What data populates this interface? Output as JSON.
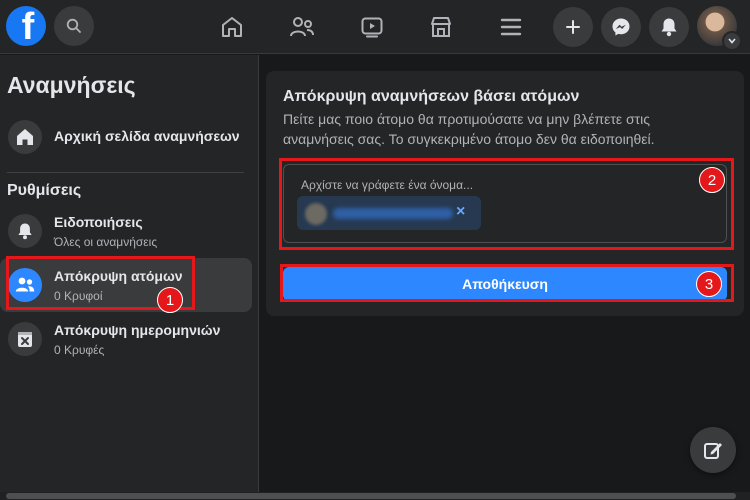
{
  "topbar": {
    "logo_letter": "f",
    "nav": [
      "home-icon",
      "friends-icon",
      "watch-icon",
      "marketplace-icon",
      "menu-icon"
    ],
    "actions": [
      "create-icon",
      "messenger-icon",
      "notifications-icon"
    ]
  },
  "sidebar": {
    "title": "Αναμνήσεις",
    "home_item": {
      "label": "Αρχική σελίδα αναμνήσεων",
      "icon": "home-icon"
    },
    "settings_heading": "Ρυθμίσεις",
    "items": [
      {
        "label": "Ειδοποιήσεις",
        "sub": "Όλες οι αναμνήσεις",
        "icon": "bell-icon"
      },
      {
        "label": "Απόκρυψη ατόμων",
        "sub": "0 Κρυφοί",
        "icon": "people-icon",
        "active": true
      },
      {
        "label": "Απόκρυψη ημερομηνιών",
        "sub": "0 Κρυφές",
        "icon": "calendar-x-icon"
      }
    ]
  },
  "panel": {
    "title": "Απόκρυψη αναμνήσεων βάσει ατόμων",
    "description": "Πείτε μας ποιο άτομο θα προτιμούσατε να μην βλέπετε στις αναμνήσεις σας. Το συγκεκριμένο άτομο δεν θα ειδοποιηθεί.",
    "input_placeholder": "Αρχίστε να γράφετε ένα όνομα...",
    "chip_remove": "×",
    "save_label": "Αποθήκευση"
  },
  "annotations": {
    "badge1": "1",
    "badge2": "2",
    "badge3": "3"
  },
  "colors": {
    "accent": "#2d88ff",
    "annotation": "#e4171b",
    "background": "#18191a",
    "surface": "#242526"
  }
}
